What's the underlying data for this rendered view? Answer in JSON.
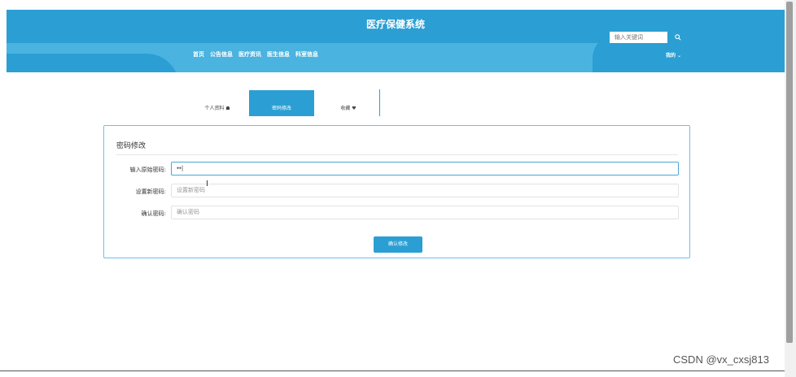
{
  "header": {
    "site_title": "医疗保健系统",
    "nav_items": [
      "首页",
      "公告信息",
      "医疗资讯",
      "医生信息",
      "科室信息"
    ],
    "search_placeholder": "输入关键词",
    "search_icon": "search-icon",
    "my_menu": "我的 ⌄"
  },
  "tabs": [
    {
      "label": "个人资料 ☗"
    },
    {
      "label": "密码修改"
    },
    {
      "label": "收藏 ♥"
    }
  ],
  "form": {
    "title": "密码修改",
    "fields": [
      {
        "label": "输入原始密码:",
        "value": "↔|",
        "placeholder": ""
      },
      {
        "label": "设置新密码:",
        "value": "",
        "placeholder": "设置新密码"
      },
      {
        "label": "确认密码:",
        "value": "",
        "placeholder": "确认密码"
      }
    ],
    "submit_label": "确认修改"
  },
  "watermark": "CSDN @vx_cxsj813",
  "colors": {
    "accent": "#2b9fd3",
    "accent_light": "#4ab3df"
  }
}
